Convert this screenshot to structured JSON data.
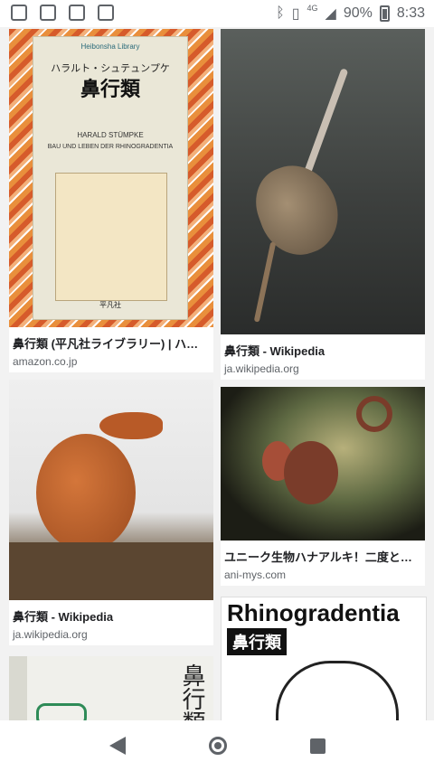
{
  "status_bar": {
    "left_icons": [
      "note-icon",
      "image-icon",
      "sim-card-icon",
      "game-controller-icon"
    ],
    "right_icons": [
      "bluetooth-icon",
      "vibrate-icon",
      "signal-icon",
      "battery-icon"
    ],
    "network": "4G",
    "battery": "90%",
    "time": "8:33"
  },
  "results": [
    {
      "title": "鼻行類 (平凡社ライブラリー) | ハラルト...",
      "domain": "amazon.co.jp",
      "book_cover": {
        "series": "Heibonsha Library",
        "author_jp": "ハラルト・シュテュンプケ",
        "title_jp": "鼻行類",
        "author_en": "HARALD STÜMPKE",
        "title_en": "BAU UND LEBEN DER RHINOGRADENTIA",
        "publisher": "平凡社"
      }
    },
    {
      "title": "鼻行類 - Wikipedia",
      "domain": "ja.wikipedia.org"
    },
    {
      "title": "鼻行類 - Wikipedia",
      "domain": "ja.wikipedia.org"
    },
    {
      "title": "ユニーク生物ハナアルキ！二度と見ら...",
      "domain": "ani-mys.com"
    },
    {
      "title": "",
      "domain": "",
      "poster": {
        "heading": "Rhinogradentia",
        "sub": "鼻行類"
      }
    },
    {
      "title": "",
      "domain": "",
      "book_cover": {
        "title_jp": "鼻行類"
      }
    }
  ],
  "nav": [
    "back-icon",
    "home-icon",
    "recent-apps-icon"
  ]
}
